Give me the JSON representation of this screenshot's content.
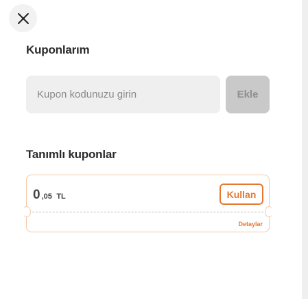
{
  "close_icon": "close-icon",
  "coupons": {
    "title": "Kuponlarım",
    "input_placeholder": "Kupon kodunuzu girin",
    "input_value": "",
    "add_label": "Ekle"
  },
  "defined_coupons": {
    "title": "Tanımlı kuponlar",
    "items": [
      {
        "amount_integer": "0",
        "amount_decimal": ",05",
        "currency": "TL",
        "use_label": "Kullan",
        "details_label": "Detaylar"
      }
    ]
  },
  "colors": {
    "accent": "#e6782f",
    "card_border": "#f3c9a8",
    "input_bg": "#efefef",
    "disabled_button_bg": "#c9c9c9",
    "title_text": "#2b2b2b"
  }
}
